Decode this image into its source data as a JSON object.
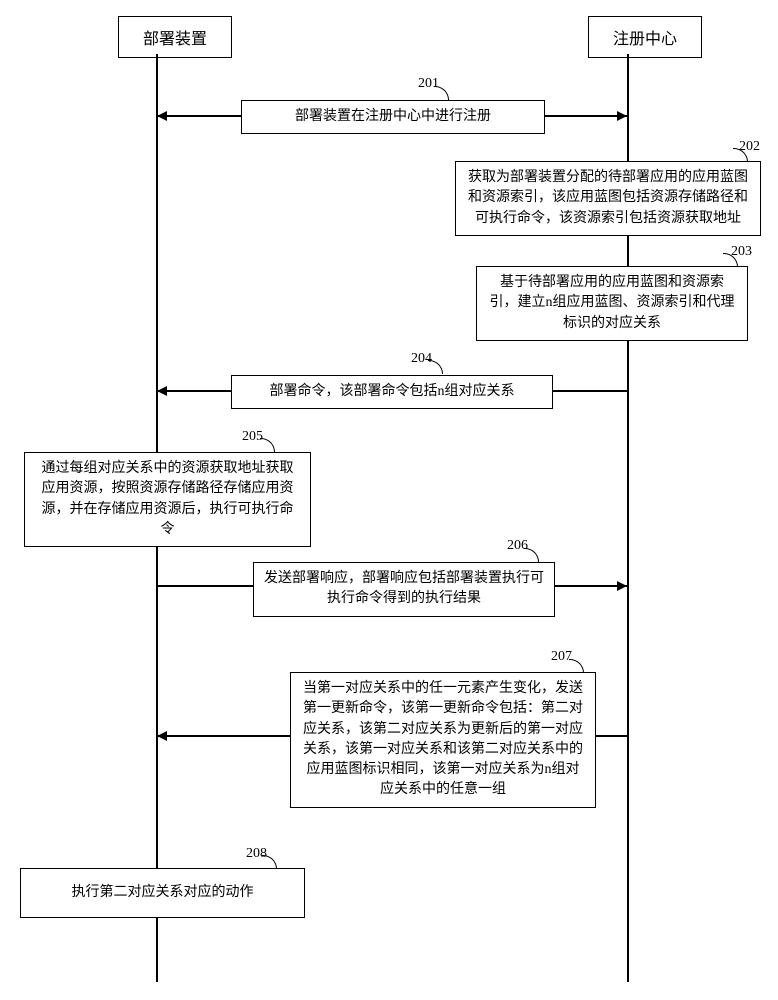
{
  "actors": {
    "left": "部署装置",
    "right": "注册中心"
  },
  "steps": {
    "s201": {
      "num": "201",
      "text": "部署装置在注册中心中进行注册"
    },
    "s202": {
      "num": "202",
      "text": "获取为部署装置分配的待部署应用的应用蓝图和资源索引，该应用蓝图包括资源存储路径和可执行命令，该资源索引包括资源获取地址"
    },
    "s203": {
      "num": "203",
      "text": "基于待部署应用的应用蓝图和资源索引，建立n组应用蓝图、资源索引和代理标识的对应关系"
    },
    "s204": {
      "num": "204",
      "text": "部署命令，该部署命令包括n组对应关系"
    },
    "s205": {
      "num": "205",
      "text": "通过每组对应关系中的资源获取地址获取应用资源，按照资源存储路径存储应用资源，并在存储应用资源后，执行可执行命令"
    },
    "s206": {
      "num": "206",
      "text": "发送部署响应，部署响应包括部署装置执行可执行命令得到的执行结果"
    },
    "s207": {
      "num": "207",
      "text": "当第一对应关系中的任一元素产生变化，发送第一更新命令，该第一更新命令包括：第二对应关系，该第二对应关系为更新后的第一对应关系，该第一对应关系和该第二对应关系中的应用蓝图标识相同，该第一对应关系为n组对应关系中的任意一组"
    },
    "s208": {
      "num": "208",
      "text": "执行第二对应关系对应的动作"
    }
  }
}
